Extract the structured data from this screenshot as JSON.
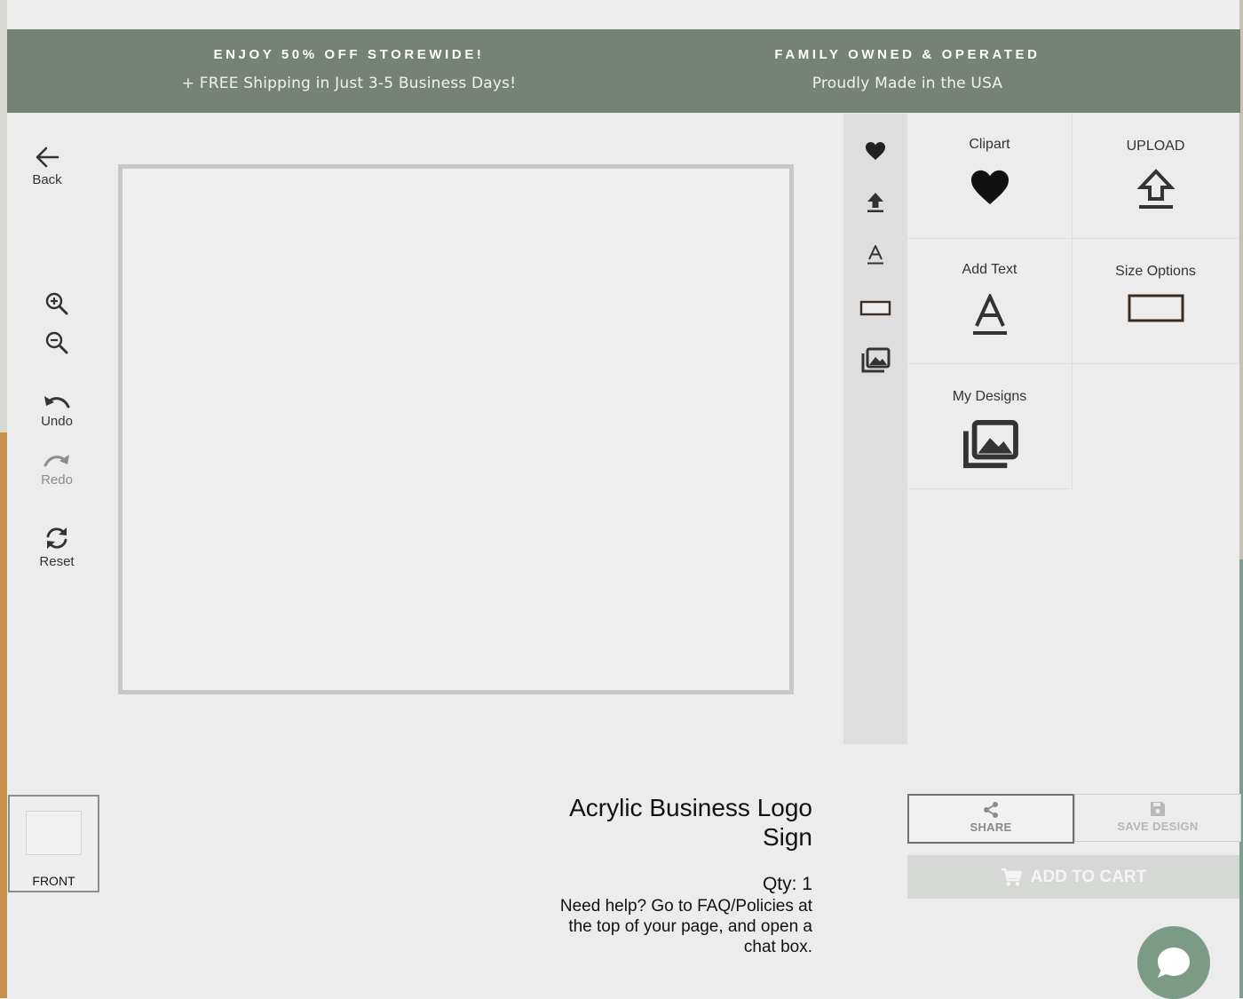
{
  "promo": {
    "left_heading": "ENJOY 50% OFF STOREWIDE!",
    "left_sub": "+ FREE Shipping in Just 3-5 Business Days!",
    "right_heading": "FAMILY OWNED & OPERATED",
    "right_sub": "Proudly Made in the USA"
  },
  "toolbar": {
    "back": "Back",
    "undo": "Undo",
    "redo": "Redo",
    "reset": "Reset",
    "redo_enabled": false
  },
  "side_tabs": [
    "heart-icon",
    "upload-icon",
    "text-icon",
    "rectangle-icon",
    "gallery-icon"
  ],
  "panel": {
    "clipart": "Clipart",
    "upload": "UPLOAD",
    "add_text": "Add Text",
    "size_options": "Size Options",
    "my_designs": "My Designs"
  },
  "views": {
    "front": "FRONT"
  },
  "product": {
    "title_line1": "Acrylic Business Logo",
    "title_line2": "Sign",
    "qty": "Qty: 1",
    "help_line1": "Need help? Go to FAQ/Policies at",
    "help_line2": "the top of your page, and open a",
    "help_line3": "chat box."
  },
  "actions": {
    "share": "SHARE",
    "save": "SAVE DESIGN",
    "add_to_cart": "ADD TO CART",
    "save_enabled": false,
    "cart_enabled": false
  },
  "colors": {
    "promo_bg": "#778276",
    "chat_bg": "#7b9b87",
    "cart_bg": "#d5d8d4"
  }
}
